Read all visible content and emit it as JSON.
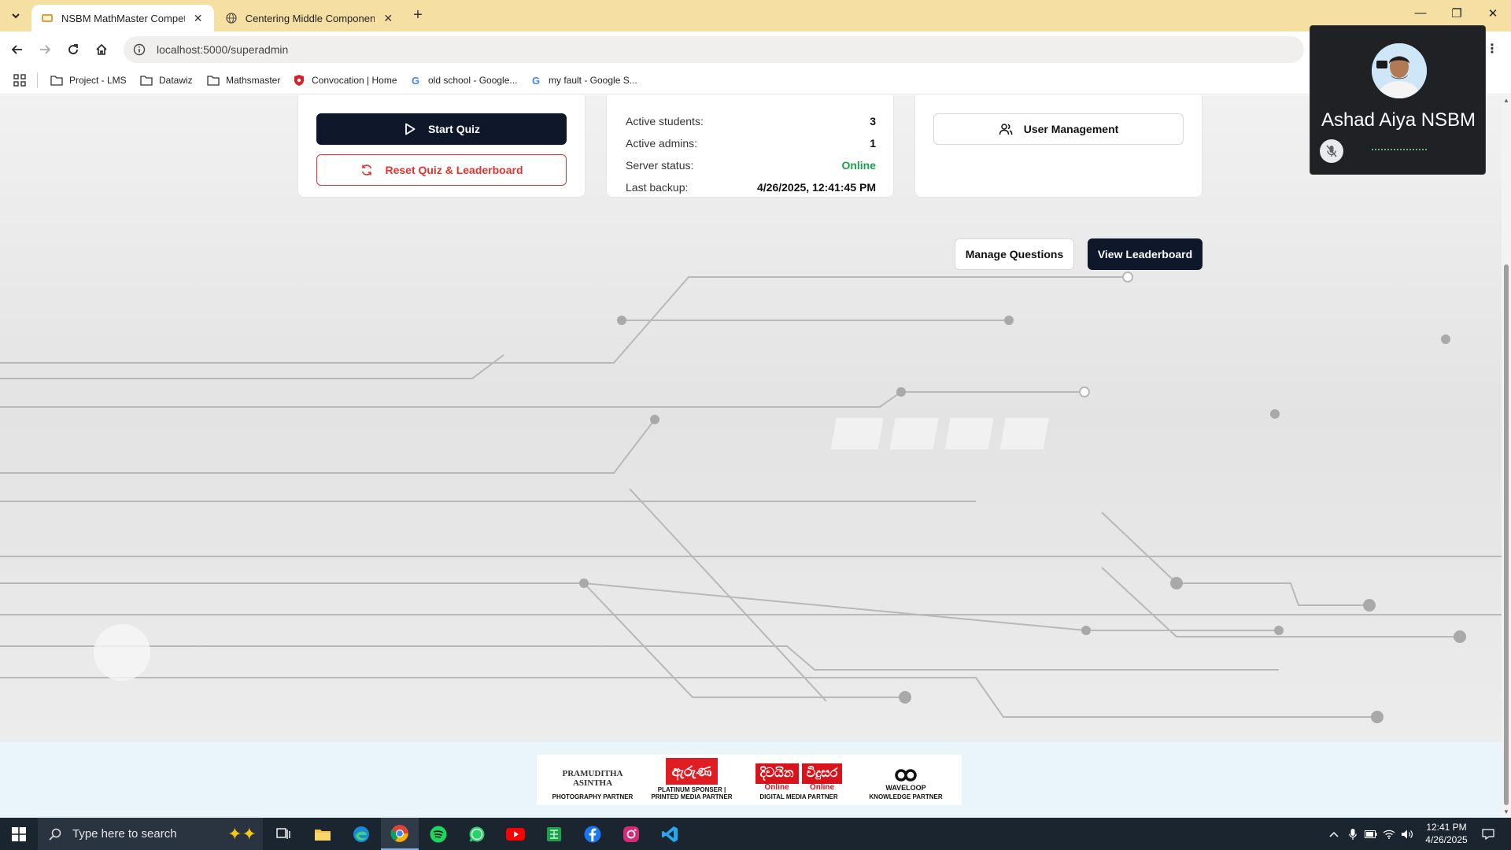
{
  "browser": {
    "tabs": [
      {
        "title": "NSBM MathMaster Competition",
        "active": true
      },
      {
        "title": "Centering Middle Component",
        "active": false
      }
    ],
    "url": "localhost:5000/superadmin",
    "bookmarks": [
      {
        "label": "Project - LMS",
        "icon": "folder-icon"
      },
      {
        "label": "Datawiz",
        "icon": "folder-icon"
      },
      {
        "label": "Mathsmaster",
        "icon": "folder-icon"
      },
      {
        "label": "Convocation | Home",
        "icon": "shield-red-icon"
      },
      {
        "label": "old school - Google...",
        "icon": "google-icon"
      },
      {
        "label": "my fault - Google S...",
        "icon": "google-icon"
      }
    ]
  },
  "quiz_controls": {
    "start_label": "Start Quiz",
    "reset_label": "Reset Quiz & Leaderboard"
  },
  "system_status": {
    "rows": [
      {
        "label": "Active students:",
        "value": "3"
      },
      {
        "label": "Active admins:",
        "value": "1"
      },
      {
        "label": "Server status:",
        "value": "Online"
      },
      {
        "label": "Last backup:",
        "value": "4/26/2025, 12:41:45 PM"
      }
    ]
  },
  "admin_tools": {
    "user_management_label": "User Management"
  },
  "actions": {
    "manage_questions_label": "Manage Questions",
    "view_leaderboard_label": "View Leaderboard"
  },
  "sponsors": [
    {
      "name": "PRAMUDITHA ASINTHA",
      "caption": "PHOTOGRAPHY PARTNER"
    },
    {
      "name": "ඇරුණ",
      "caption": "PLATINUM SPONSER | PRINTED MEDIA PARTNER"
    },
    {
      "name": "දිවයින",
      "caption": "DIGITAL MEDIA PARTNER"
    },
    {
      "name": "විදුසර",
      "caption": ""
    },
    {
      "name": "WAVELOOP",
      "caption": "KNOWLEDGE PARTNER"
    }
  ],
  "sponsor_extra": {
    "online_a": "Online",
    "online_b": "Online"
  },
  "meet": {
    "participant_name": "Ashad Aiya NSBM",
    "mic_muted": true
  },
  "taskbar": {
    "search_placeholder": "Type here to search",
    "time": "12:41 PM",
    "date": "4/26/2025"
  },
  "colors": {
    "tabbar": "#f6dfa3",
    "primary_dark": "#0f172a",
    "danger": "#e0342f",
    "online": "#16a34a"
  }
}
